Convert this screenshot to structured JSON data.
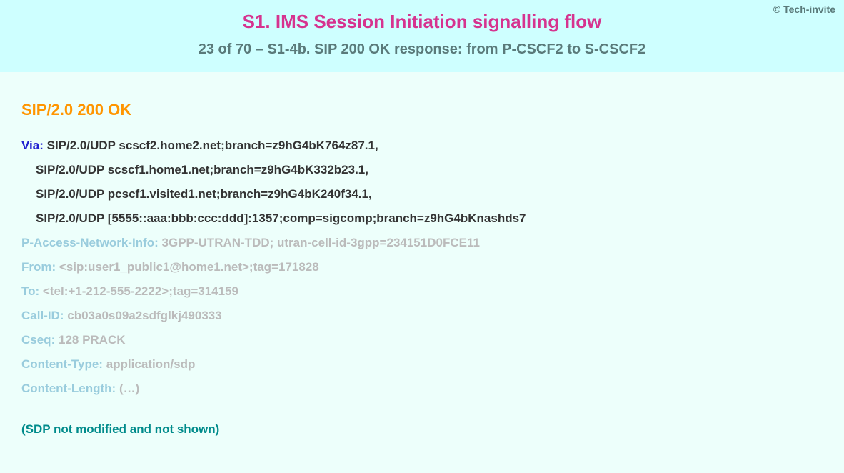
{
  "copyright": "© Tech-invite",
  "header": {
    "title": "S1. IMS Session Initiation signalling flow",
    "subtitle": "23 of 70 – S1-4b. SIP 200 OK response: from P-CSCF2 to S-CSCF2"
  },
  "sip": {
    "status_line": "SIP/2.0 200 OK",
    "via": {
      "name": "Via",
      "line1": "SIP/2.0/UDP scscf2.home2.net;branch=z9hG4bK764z87.1,",
      "line2": "SIP/2.0/UDP scscf1.home1.net;branch=z9hG4bK332b23.1,",
      "line3": "SIP/2.0/UDP pcscf1.visited1.net;branch=z9hG4bK240f34.1,",
      "line4": "SIP/2.0/UDP [5555::aaa:bbb:ccc:ddd]:1357;comp=sigcomp;branch=z9hG4bKnashds7"
    },
    "pani": {
      "name": "P-Access-Network-Info",
      "value": "3GPP-UTRAN-TDD; utran-cell-id-3gpp=234151D0FCE11"
    },
    "from": {
      "name": "From",
      "value": "<sip:user1_public1@home1.net>;tag=171828"
    },
    "to": {
      "name": "To",
      "value": "<tel:+1-212-555-2222>;tag=314159"
    },
    "callid": {
      "name": "Call-ID",
      "value": "cb03a0s09a2sdfglkj490333"
    },
    "cseq": {
      "name": "Cseq",
      "value": "128 PRACK"
    },
    "ctype": {
      "name": "Content-Type",
      "value": "application/sdp"
    },
    "clen": {
      "name": "Content-Length",
      "value": "(…)"
    },
    "sdp_note": "(SDP not modified and not shown)"
  }
}
